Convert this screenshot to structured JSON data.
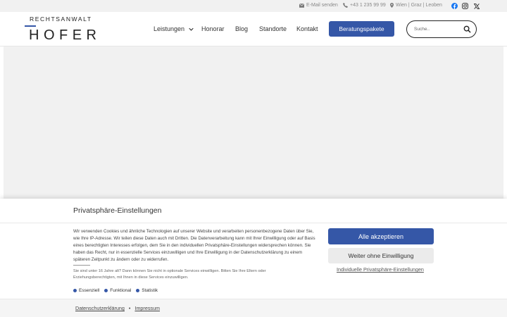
{
  "topbar": {
    "email": "E-Mail senden",
    "phone": "+43 1 235 99 99",
    "location": "Wien | Graz | Leoben",
    "icons": [
      "envelope-icon",
      "phone-icon",
      "map-marker-icon",
      "facebook-icon",
      "instagram-icon",
      "x-icon"
    ]
  },
  "header": {
    "logo_top": "RECHTSANWALT",
    "logo_main": "HOFER",
    "nav": [
      "Leistungen",
      "Honorar",
      "Blog",
      "Standorte",
      "Kontakt"
    ],
    "cta_label": "Beratungspakete",
    "search_placeholder": "Suche.."
  },
  "consent": {
    "title": "Privatsphäre-Einstellungen",
    "text": "Wir verwenden Cookies und ähnliche Technologien auf unserer Website und verarbeiten personenbezogene Daten über Sie, wie Ihre IP-Adresse. Wir teilen diese Daten auch mit Dritten. Die Datenverarbeitung kann mit Ihrer Einwilligung oder auf Basis eines berechtigten Interesses erfolgen, dem Sie in den individuellen Privatsphäre-Einstellungen widersprechen können. Sie haben das Recht, nur in essenzielle Services einzuwilligen und Ihre Einwilligung in der Datenschutzerklärung zu einem späteren Zeitpunkt zu ändern oder zu widerrufen.",
    "age_text": "Sie sind unter 16 Jahre alt? Dann können Sie nicht in optionale Services einwilligen. Bitten Sie Ihre Eltern oder Erziehungsberechtigten, mit Ihnen in diese Services einzuwilligen.",
    "categories": [
      "Essenziell",
      "Funktional",
      "Statistik"
    ],
    "accept_label": "Alle akzeptieren",
    "deny_label": "Weiter ohne Einwilligung",
    "individual_label": "Individuelle Privatsphäre-Einstellungen",
    "footer_links": [
      "Datenschutzerklärung",
      "Impressum"
    ],
    "footer_separator": "•"
  },
  "colors": {
    "accent": "#3557a7",
    "topbar_bg": "#f1f1f1",
    "facebook": "#1877f2"
  }
}
